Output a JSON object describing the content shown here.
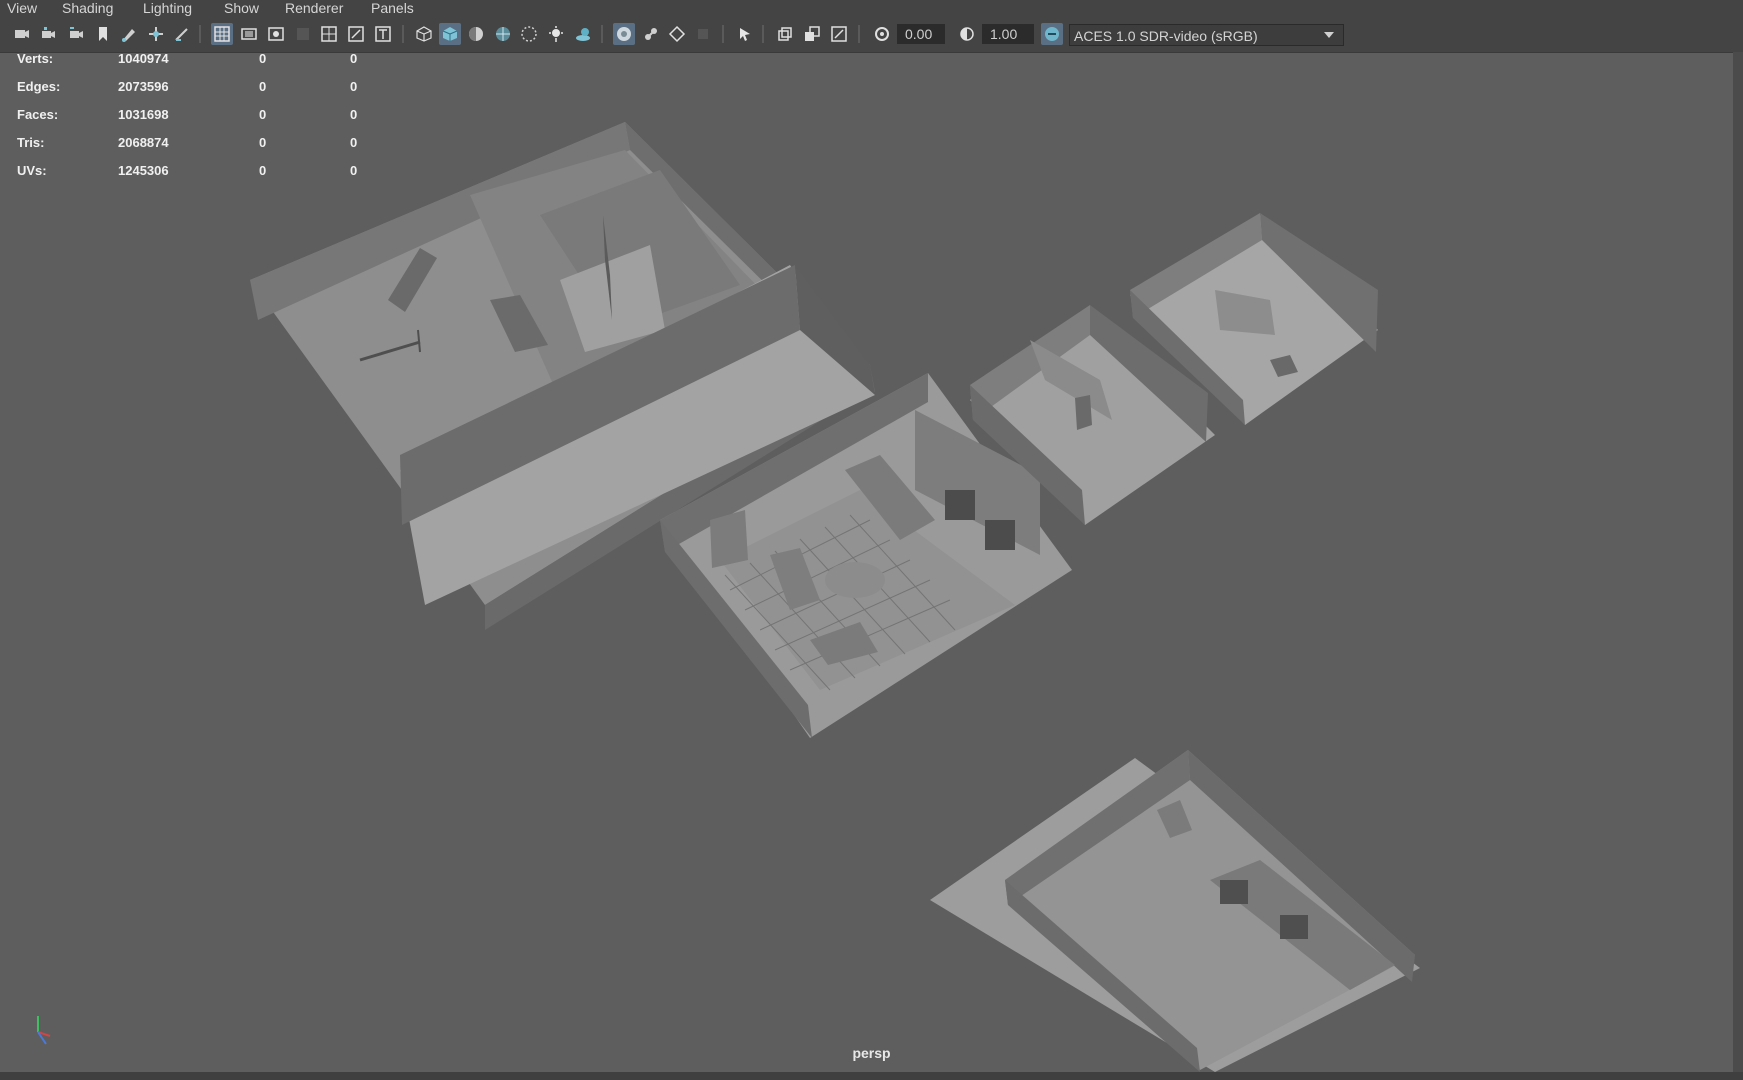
{
  "menu": [
    "View",
    "Shading",
    "Lighting",
    "Show",
    "Renderer",
    "Panels"
  ],
  "toolbar": {
    "exposure_value": "0.00",
    "gamma_value": "1.00",
    "colorspace_label": "ACES 1.0 SDR-video (sRGB)",
    "icons": [
      "camera-select-icon",
      "camera-attributes-icon",
      "camera-pan-icon",
      "bookmark-icon",
      "grease-pencil-icon",
      "image-plane-icon",
      "two-d-pan-icon",
      "grid-icon",
      "film-gate-icon",
      "resolution-gate-icon",
      "gate-mask-icon",
      "field-chart-icon",
      "safe-action-icon",
      "safe-title-icon",
      "wireframe-icon",
      "smooth-shade-icon",
      "default-material-icon",
      "wireframe-on-shaded-icon",
      "textured-icon",
      "use-all-lights-icon",
      "shadows-icon",
      "xray-icon",
      "xray-joints-icon",
      "xray-active-icon",
      "isolate-select-icon",
      "backface-culling-icon",
      "screen-space-ao-icon",
      "motion-blur-icon",
      "multisample-aa-icon",
      "exposure-icon",
      "gamma-icon",
      "color-management-icon",
      "dropdown-arrow-icon"
    ]
  },
  "hud": {
    "rows": [
      {
        "label": "Verts:",
        "v1": "1040974",
        "v2": "0",
        "v3": "0"
      },
      {
        "label": "Edges:",
        "v1": "2073596",
        "v2": "0",
        "v3": "0"
      },
      {
        "label": "Faces:",
        "v1": "1031698",
        "v2": "0",
        "v3": "0"
      },
      {
        "label": "Tris:",
        "v1": "2068874",
        "v2": "0",
        "v3": "0"
      },
      {
        "label": "UVs:",
        "v1": "1245306",
        "v2": "0",
        "v3": "0"
      }
    ]
  },
  "viewport": {
    "camera_label": "persp",
    "axis_icon": "axis-gizmo-icon"
  },
  "colors": {
    "viewport_bg": "#5e5e5e",
    "floor": "#979797",
    "wall_light": "#8a8a8a",
    "wall_dark": "#6e6e6e",
    "toolbar_bg": "#444444",
    "active_button": "#5b6f84"
  }
}
